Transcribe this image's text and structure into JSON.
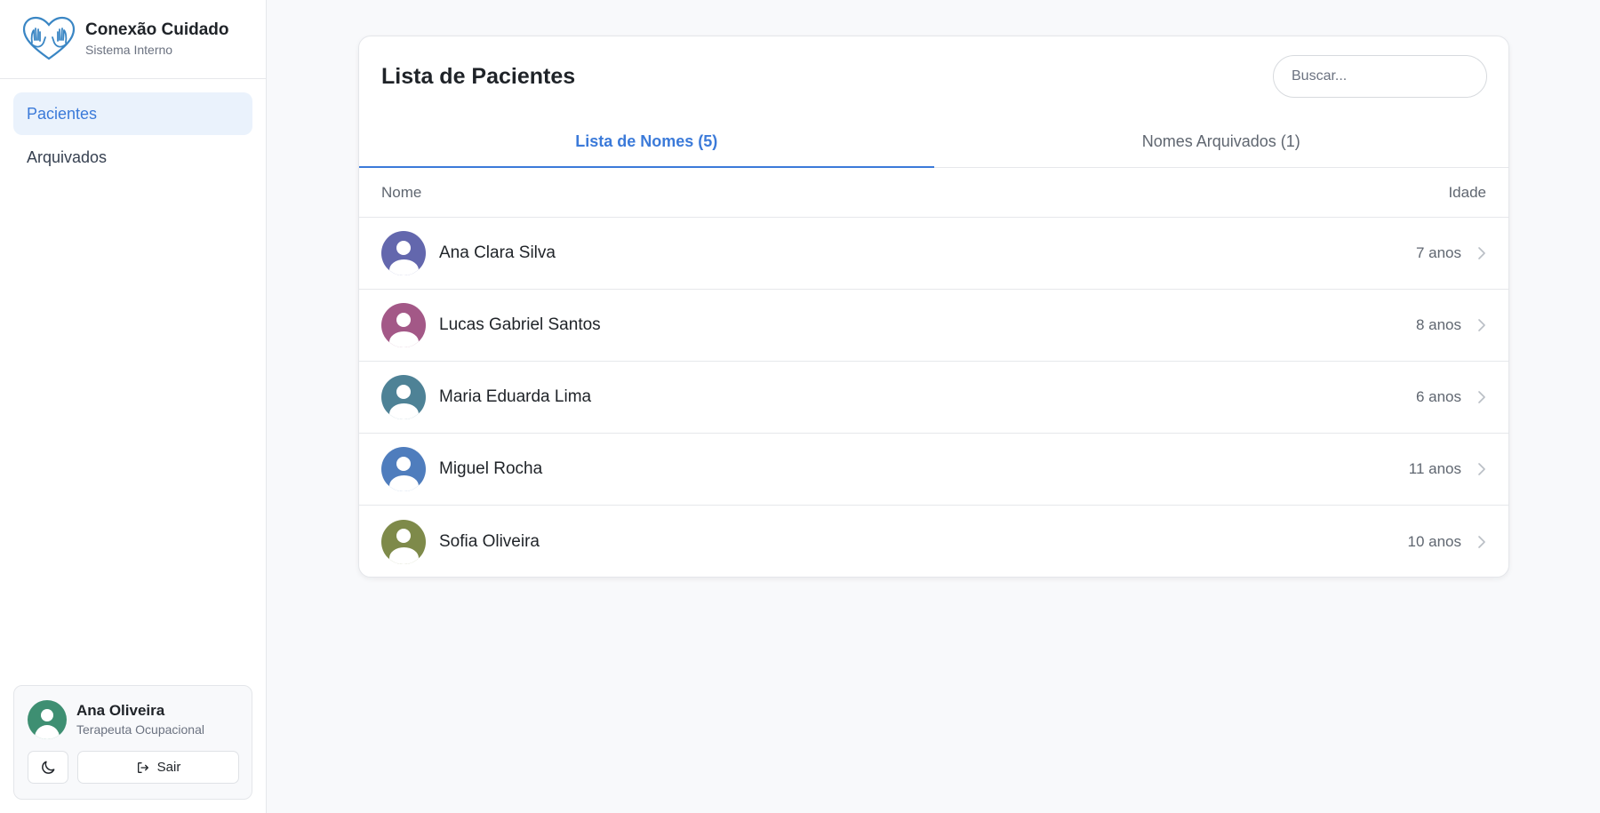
{
  "brand": {
    "title": "Conexão Cuidado",
    "subtitle": "Sistema Interno"
  },
  "nav": [
    {
      "label": "Pacientes",
      "active": true
    },
    {
      "label": "Arquivados",
      "active": false
    }
  ],
  "user": {
    "name": "Ana Oliveira",
    "role": "Terapeuta Ocupacional",
    "avatar_color": "#3e8f72",
    "logout_label": "Sair"
  },
  "main": {
    "title": "Lista de Pacientes",
    "search": {
      "placeholder": "Buscar...",
      "value": ""
    },
    "tabs": [
      {
        "label": "Lista de Nomes (5)",
        "active": true
      },
      {
        "label": "Nomes Arquivados (1)",
        "active": false
      }
    ],
    "columns": {
      "name": "Nome",
      "age": "Idade"
    },
    "patients": [
      {
        "name": "Ana Clara Silva",
        "age": "7 anos",
        "color": "#6367ad"
      },
      {
        "name": "Lucas Gabriel Santos",
        "age": "8 anos",
        "color": "#a35887"
      },
      {
        "name": "Maria Eduarda Lima",
        "age": "6 anos",
        "color": "#4e8296"
      },
      {
        "name": "Miguel Rocha",
        "age": "11 anos",
        "color": "#4f7dbd"
      },
      {
        "name": "Sofia Oliveira",
        "age": "10 anos",
        "color": "#7e8a4a"
      }
    ]
  },
  "colors": {
    "accent": "#3b7ad9",
    "accent_bg": "#eaf2fc"
  }
}
